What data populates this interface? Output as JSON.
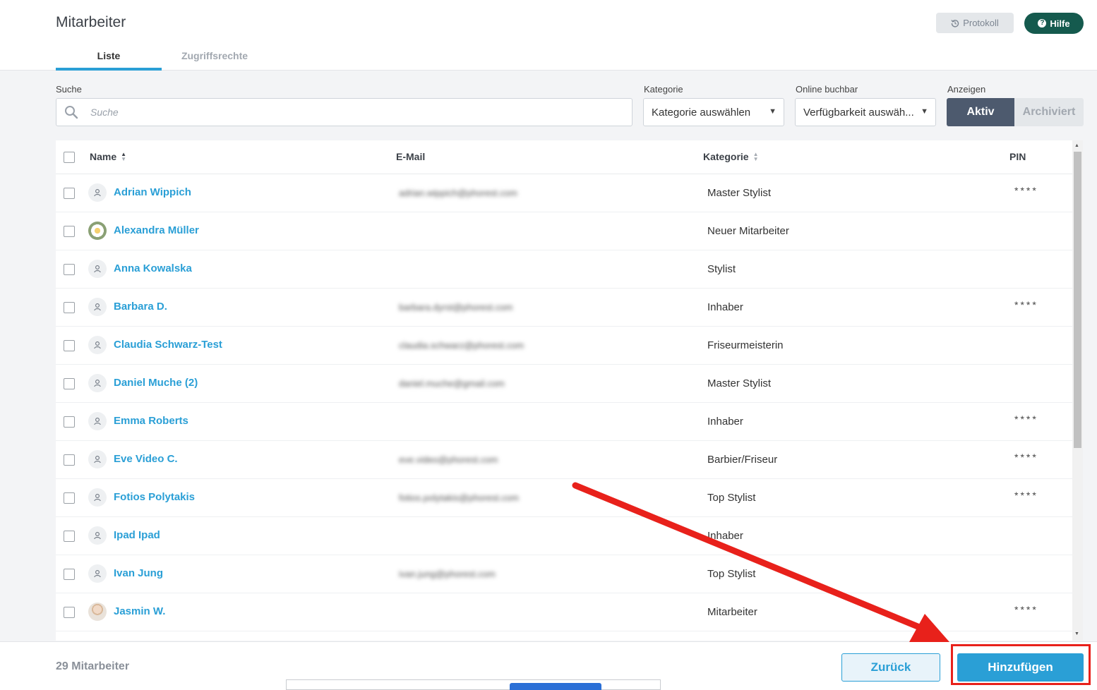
{
  "header": {
    "title": "Mitarbeiter",
    "protokoll_label": "Protokoll",
    "hilfe_label": "Hilfe"
  },
  "tabs": [
    {
      "label": "Liste",
      "active": true
    },
    {
      "label": "Zugriffsrechte",
      "active": false
    }
  ],
  "filters": {
    "search_label": "Suche",
    "search_placeholder": "Suche",
    "kategorie_label": "Kategorie",
    "kategorie_value": "Kategorie auswählen",
    "online_label": "Online buchbar",
    "online_value": "Verfügbarkeit auswäh...",
    "anzeigen_label": "Anzeigen",
    "aktiv_label": "Aktiv",
    "archiviert_label": "Archiviert"
  },
  "table": {
    "columns": {
      "name": "Name",
      "email": "E-Mail",
      "kategorie": "Kategorie",
      "pin": "PIN"
    },
    "rows": [
      {
        "name": "Adrian Wippich",
        "email": "adrian.wippich@phorest.com",
        "kategorie": "Master Stylist",
        "pin": "****",
        "avatar": "user-icon"
      },
      {
        "name": "Alexandra Müller",
        "email": "",
        "kategorie": "Neuer Mitarbeiter",
        "pin": "",
        "avatar": "photo"
      },
      {
        "name": "Anna Kowalska",
        "email": "",
        "kategorie": "Stylist",
        "pin": "",
        "avatar": "user-icon"
      },
      {
        "name": "Barbara D.",
        "email": "barbara.dyrst@phorest.com",
        "kategorie": "Inhaber",
        "pin": "****",
        "avatar": "user-icon"
      },
      {
        "name": "Claudia Schwarz-Test",
        "email": "claudia.schwarz@phorest.com",
        "kategorie": "Friseurmeisterin",
        "pin": "",
        "avatar": "user-icon"
      },
      {
        "name": "Daniel Muche (2)",
        "email": "daniel.muche@gmail.com",
        "kategorie": "Master Stylist",
        "pin": "",
        "avatar": "user-icon"
      },
      {
        "name": "Emma Roberts",
        "email": "",
        "kategorie": "Inhaber",
        "pin": "****",
        "avatar": "user-icon"
      },
      {
        "name": "Eve Video C.",
        "email": "eve.video@phorest.com",
        "kategorie": "Barbier/Friseur",
        "pin": "****",
        "avatar": "user-icon"
      },
      {
        "name": "Fotios Polytakis",
        "email": "fotios.polytakis@phorest.com",
        "kategorie": "Top Stylist",
        "pin": "****",
        "avatar": "user-icon"
      },
      {
        "name": "Ipad Ipad",
        "email": "",
        "kategorie": "Inhaber",
        "pin": "",
        "avatar": "user-icon"
      },
      {
        "name": "Ivan Jung",
        "email": "ivan.jung@phorest.com",
        "kategorie": "Top Stylist",
        "pin": "",
        "avatar": "user-icon"
      },
      {
        "name": "Jasmin W.",
        "email": "",
        "kategorie": "Mitarbeiter",
        "pin": "****",
        "avatar": "photo"
      }
    ]
  },
  "footer": {
    "count": "29 Mitarbeiter",
    "zurueck_label": "Zurück",
    "hinzufuegen_label": "Hinzufügen"
  },
  "colors": {
    "accent": "#2a9fd6",
    "hilfe_bg": "#155a4e",
    "toggle_active": "#4d5a6e",
    "annotation_red": "#e8211b"
  }
}
